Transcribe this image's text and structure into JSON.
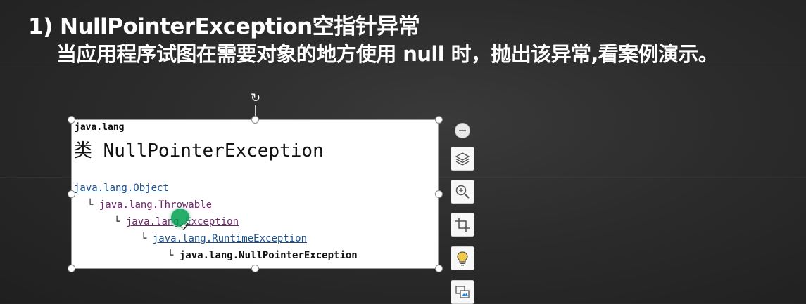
{
  "slide": {
    "heading_line1": "1) NullPointerException空指针异常",
    "heading_line2": "当应用程序试图在需要对象的地方使用 null 时，抛出该异常,看案例演示。"
  },
  "image": {
    "package_label": "java.lang",
    "class_title": "类 NullPointerException",
    "hierarchy": [
      {
        "connector": "",
        "text": "java.lang.Object",
        "is_link": true
      },
      {
        "connector": "└",
        "text": "java.lang.Throwable",
        "is_link": true
      },
      {
        "connector": "└",
        "text": "java.lang.Exception",
        "is_link": true
      },
      {
        "connector": "└",
        "text": "java.lang.RuntimeException",
        "is_link": true
      },
      {
        "connector": "└",
        "text": "java.lang.NullPointerException",
        "is_link": false
      }
    ]
  },
  "image_tools": {
    "buttons": [
      {
        "name": "layout-options",
        "icon": "layers-icon"
      },
      {
        "name": "zoom",
        "icon": "zoom-in-icon"
      },
      {
        "name": "crop",
        "icon": "crop-icon"
      },
      {
        "name": "design-ideas",
        "icon": "lightbulb-icon"
      },
      {
        "name": "alt-text",
        "icon": "image-edit-icon"
      }
    ]
  },
  "colors": {
    "link": "#1a4e8c",
    "visited_link": "#6c2a6a",
    "cursor_highlight": "#00a050"
  }
}
